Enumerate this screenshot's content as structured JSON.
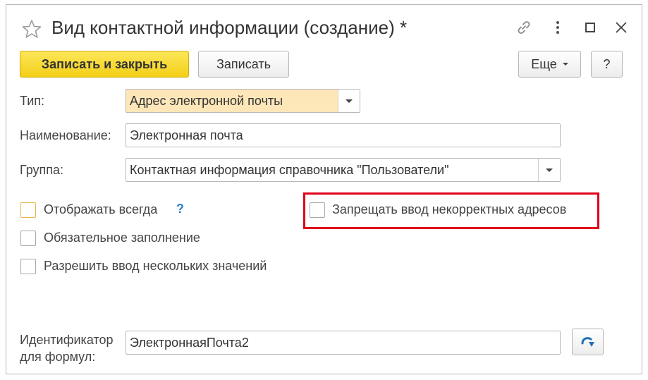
{
  "window": {
    "title": "Вид контактной информации (создание) *"
  },
  "toolbar": {
    "save_close_label": "Записать и закрыть",
    "save_label": "Записать",
    "more_label": "Еще",
    "help_label": "?"
  },
  "form": {
    "type_label": "Тип:",
    "type_value": "Адрес электронной почты",
    "name_label": "Наименование:",
    "name_value": "Электронная почта",
    "group_label": "Группа:",
    "group_value": "Контактная информация справочника \"Пользователи\"",
    "checkboxes": {
      "always_show": {
        "label": "Отображать всегда",
        "checked": false
      },
      "mandatory": {
        "label": "Обязательное заполнение",
        "checked": false
      },
      "multiple": {
        "label": "Разрешить ввод нескольких значений",
        "checked": false
      },
      "forbid_invalid": {
        "label": "Запрещать ввод некорректных адресов",
        "checked": false
      }
    },
    "help_mark": "?",
    "identifier_label_line1": "Идентификатор",
    "identifier_label_line2": "для формул:",
    "identifier_value": "ЭлектроннаяПочта2"
  },
  "icons": {
    "favorite": "star-icon",
    "link": "link-icon",
    "menu": "kebab-menu-icon",
    "maximize": "maximize-icon",
    "close": "close-icon",
    "transfer": "arrow-icon"
  },
  "colors": {
    "primary_button": "#f5d320",
    "highlight_field": "#fde6b8",
    "callout_border": "#e1001a",
    "help_blue": "#2c7fc4"
  }
}
